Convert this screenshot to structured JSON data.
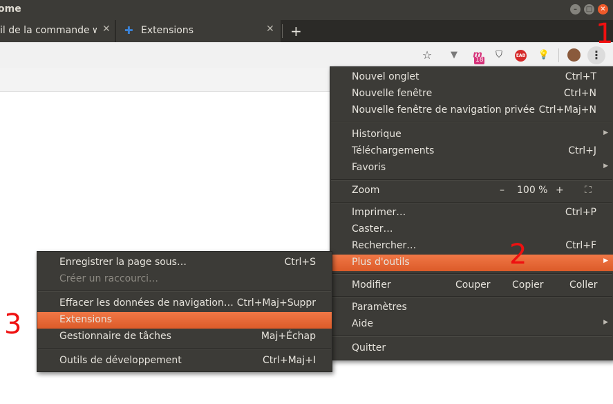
{
  "window": {
    "title": "ome"
  },
  "tabs": [
    {
      "label": "il de la commande we"
    },
    {
      "label": "Extensions"
    }
  ],
  "newtab_label": "+",
  "extensions_badge": "18",
  "extensions_small": "EAB",
  "main_menu": {
    "items": [
      {
        "label": "Nouvel onglet",
        "shortcut": "Ctrl+T"
      },
      {
        "label": "Nouvelle fenêtre",
        "shortcut": "Ctrl+N"
      },
      {
        "label": "Nouvelle fenêtre de navigation privée",
        "shortcut": "Ctrl+Maj+N"
      },
      {
        "label": "Historique"
      },
      {
        "label": "Téléchargements",
        "shortcut": "Ctrl+J"
      },
      {
        "label": "Favoris"
      },
      {
        "label": "Zoom"
      },
      {
        "label": "Imprimer…",
        "shortcut": "Ctrl+P"
      },
      {
        "label": "Caster…"
      },
      {
        "label": "Rechercher…",
        "shortcut": "Ctrl+F"
      },
      {
        "label": "Plus d'outils"
      },
      {
        "label": "Modifier"
      },
      {
        "label": "Paramètres"
      },
      {
        "label": "Aide"
      },
      {
        "label": "Quitter"
      }
    ],
    "zoom": {
      "minus": "–",
      "value": "100 %",
      "plus": "+"
    },
    "edit": {
      "cut": "Couper",
      "copy": "Copier",
      "paste": "Coller"
    }
  },
  "submenu": {
    "items": [
      {
        "label": "Enregistrer la page sous…",
        "shortcut": "Ctrl+S"
      },
      {
        "label": "Créer un raccourci…"
      },
      {
        "label": "Effacer les données de navigation…",
        "shortcut": "Ctrl+Maj+Suppr"
      },
      {
        "label": "Extensions"
      },
      {
        "label": "Gestionnaire de tâches",
        "shortcut": "Maj+Échap"
      },
      {
        "label": "Outils de développement",
        "shortcut": "Ctrl+Maj+I"
      }
    ]
  },
  "annotations": {
    "one": "1",
    "two": "2",
    "three": "3"
  },
  "colors": {
    "menu_bg": "#3c3b37",
    "highlight": "#e8622d",
    "annotation": "#ef1010"
  }
}
